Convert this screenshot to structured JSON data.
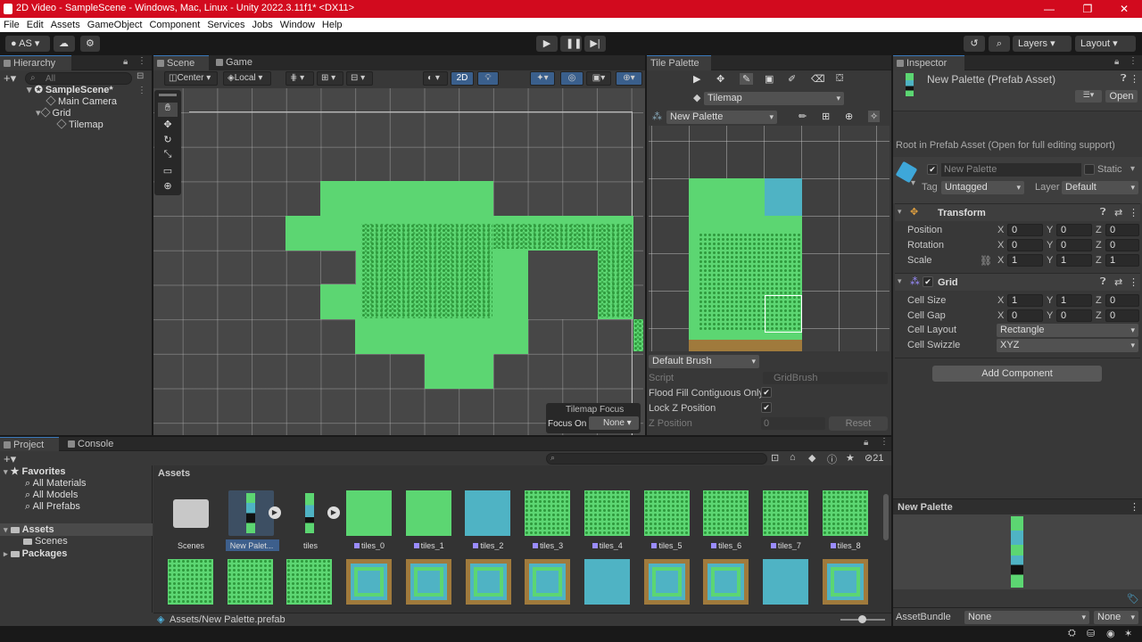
{
  "window": {
    "title": "2D Video - SampleScene - Windows, Mac, Linux - Unity 2022.3.11f1* <DX11>",
    "minimize": "—",
    "maximize": "❐",
    "close": "✕"
  },
  "menu": [
    "File",
    "Edit",
    "Assets",
    "GameObject",
    "Component",
    "Services",
    "Jobs",
    "Window",
    "Help"
  ],
  "toolbar": {
    "account": "AS",
    "layers": "Layers",
    "layout": "Layout"
  },
  "hierarchy": {
    "tab": "Hierarchy",
    "search_placeholder": "All",
    "items": [
      {
        "label": "SampleScene*"
      },
      {
        "label": "Main Camera"
      },
      {
        "label": "Grid"
      },
      {
        "label": "Tilemap"
      }
    ]
  },
  "scene": {
    "tabs": [
      "Scene",
      "Game"
    ],
    "pivot": "Center",
    "space": "Local",
    "mode_2d": "2D",
    "overlay": {
      "title": "Tilemap Focus",
      "focus_label": "Focus On",
      "focus_value": "None"
    }
  },
  "tile_palette": {
    "tab": "Tile Palette",
    "target": "Tilemap",
    "palette": "New Palette",
    "brush": "Default Brush",
    "script_label": "Script",
    "script_value": "GridBrush",
    "flood_fill_label": "Flood Fill Contiguous Only",
    "lock_z_label": "Lock Z Position",
    "z_position_label": "Z Position",
    "z_position_value": "0",
    "reset_label": "Reset"
  },
  "inspector": {
    "tab": "Inspector",
    "asset_title": "New Palette (Prefab Asset)",
    "open_label": "Open",
    "root_note": "Root in Prefab Asset (Open for full editing support)",
    "object_name": "New Palette",
    "static_label": "Static",
    "tag_label": "Tag",
    "tag_value": "Untagged",
    "layer_label": "Layer",
    "layer_value": "Default",
    "transform": {
      "title": "Transform",
      "rows": [
        {
          "label": "Position",
          "x": "0",
          "y": "0",
          "z": "0"
        },
        {
          "label": "Rotation",
          "x": "0",
          "y": "0",
          "z": "0"
        },
        {
          "label": "Scale",
          "x": "1",
          "y": "1",
          "z": "1"
        }
      ]
    },
    "grid": {
      "title": "Grid",
      "cell_size_label": "Cell Size",
      "cell_size": {
        "x": "1",
        "y": "1",
        "z": "0"
      },
      "cell_gap_label": "Cell Gap",
      "cell_gap": {
        "x": "0",
        "y": "0",
        "z": "0"
      },
      "cell_layout_label": "Cell Layout",
      "cell_layout_value": "Rectangle",
      "cell_swizzle_label": "Cell Swizzle",
      "cell_swizzle_value": "XYZ"
    },
    "add_component": "Add Component",
    "preview_title": "New Palette",
    "asset_bundle_label": "AssetBundle",
    "asset_bundle_value": "None",
    "asset_bundle_variant": "None"
  },
  "project": {
    "tabs": [
      "Project",
      "Console"
    ],
    "hidden_count": "21",
    "favorites": {
      "label": "Favorites",
      "items": [
        "All Materials",
        "All Models",
        "All Prefabs"
      ]
    },
    "assets_label": "Assets",
    "assets_children": [
      "Scenes"
    ],
    "packages_label": "Packages",
    "breadcrumb": "Assets",
    "path": "Assets/New Palette.prefab",
    "row1": [
      "Scenes",
      "New Palet...",
      "tiles",
      "tiles_0",
      "tiles_1",
      "tiles_2",
      "tiles_3",
      "tiles_4",
      "tiles_5",
      "tiles_6",
      "tiles_7",
      "tiles_8"
    ]
  }
}
